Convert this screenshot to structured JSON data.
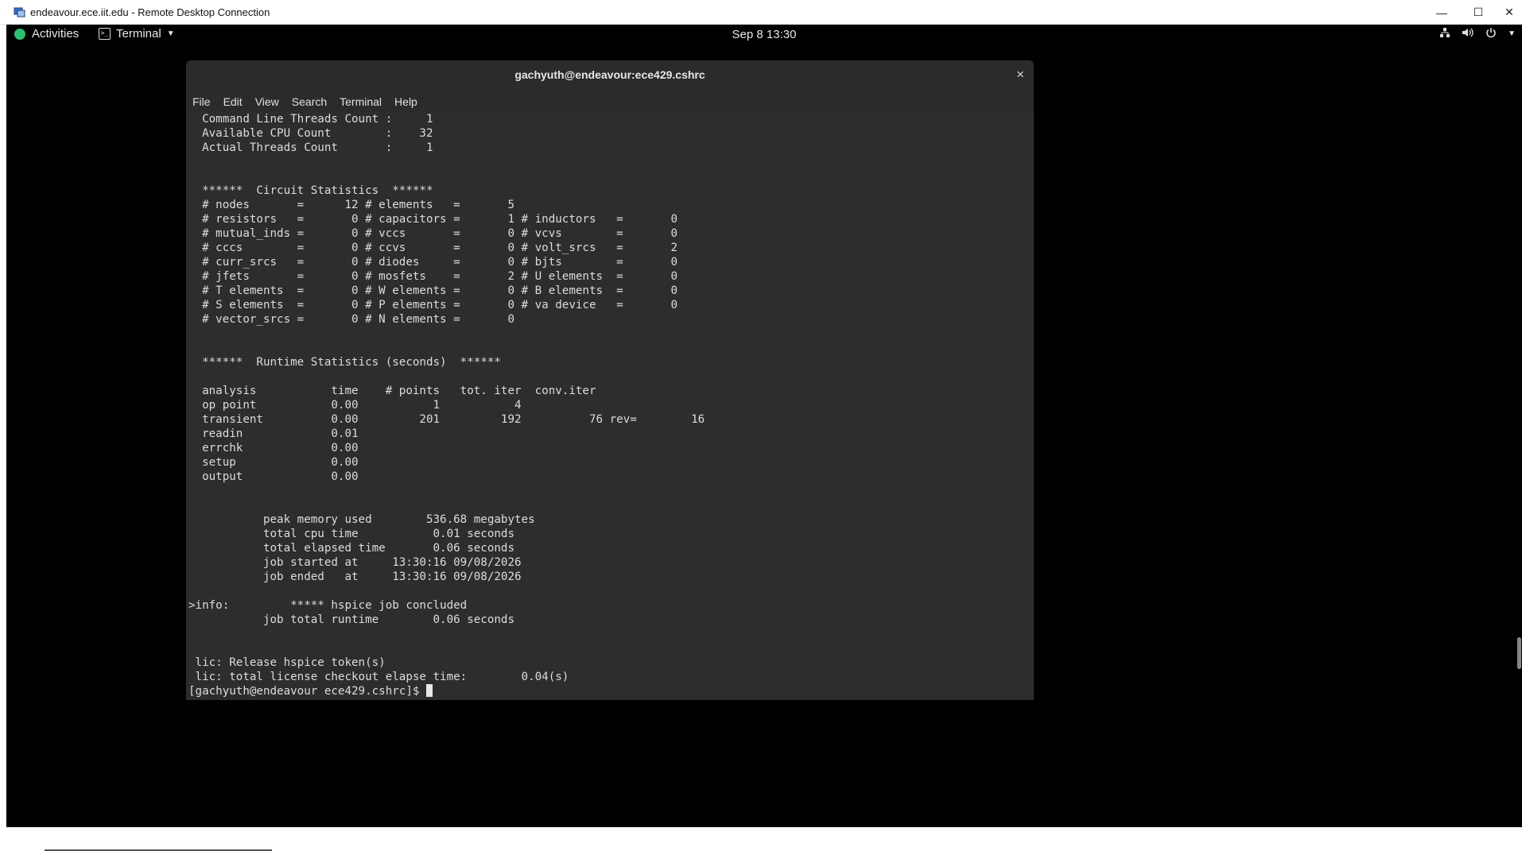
{
  "rdp": {
    "title": "endeavour.ece.iit.edu - Remote Desktop Connection",
    "controls": {
      "minimize": "—",
      "maximize": "☐",
      "close": "✕"
    }
  },
  "topbar": {
    "activities": "Activities",
    "app": "Terminal",
    "clock": "Sep 8  13:30",
    "tray_icons": [
      "network-icon",
      "volume-icon",
      "power-icon",
      "chevron-down-icon"
    ]
  },
  "terminal": {
    "title": "gachyuth@endeavour:ece429.cshrc",
    "close": "×",
    "menu": [
      "File",
      "Edit",
      "View",
      "Search",
      "Terminal",
      "Help"
    ],
    "lines": [
      "  Command Line Threads Count :     1",
      "  Available CPU Count        :    32",
      "  Actual Threads Count       :     1",
      "",
      "",
      "  ******  Circuit Statistics  ******",
      "  # nodes       =      12 # elements   =       5",
      "  # resistors   =       0 # capacitors =       1 # inductors   =       0",
      "  # mutual_inds =       0 # vccs       =       0 # vcvs        =       0",
      "  # cccs        =       0 # ccvs       =       0 # volt_srcs   =       2",
      "  # curr_srcs   =       0 # diodes     =       0 # bjts        =       0",
      "  # jfets       =       0 # mosfets    =       2 # U elements  =       0",
      "  # T elements  =       0 # W elements =       0 # B elements  =       0",
      "  # S elements  =       0 # P elements =       0 # va device   =       0",
      "  # vector_srcs =       0 # N elements =       0",
      "",
      "",
      "  ******  Runtime Statistics (seconds)  ******",
      "",
      "  analysis           time    # points   tot. iter  conv.iter",
      "  op point           0.00           1           4",
      "  transient          0.00         201         192          76 rev=        16",
      "  readin             0.01",
      "  errchk             0.00",
      "  setup              0.00",
      "  output             0.00",
      "",
      "",
      "           peak memory used        536.68 megabytes",
      "           total cpu time           0.01 seconds",
      "           total elapsed time       0.06 seconds",
      "           job started at     13:30:16 09/08/2026",
      "           job ended   at     13:30:16 09/08/2026",
      "",
      ">info:         ***** hspice job concluded",
      "           job total runtime        0.06 seconds",
      "",
      "",
      " lic: Release hspice token(s)",
      " lic: total license checkout elapse time:        0.04(s)"
    ],
    "prompt": "[gachyuth@endeavour ece429.cshrc]$ "
  }
}
